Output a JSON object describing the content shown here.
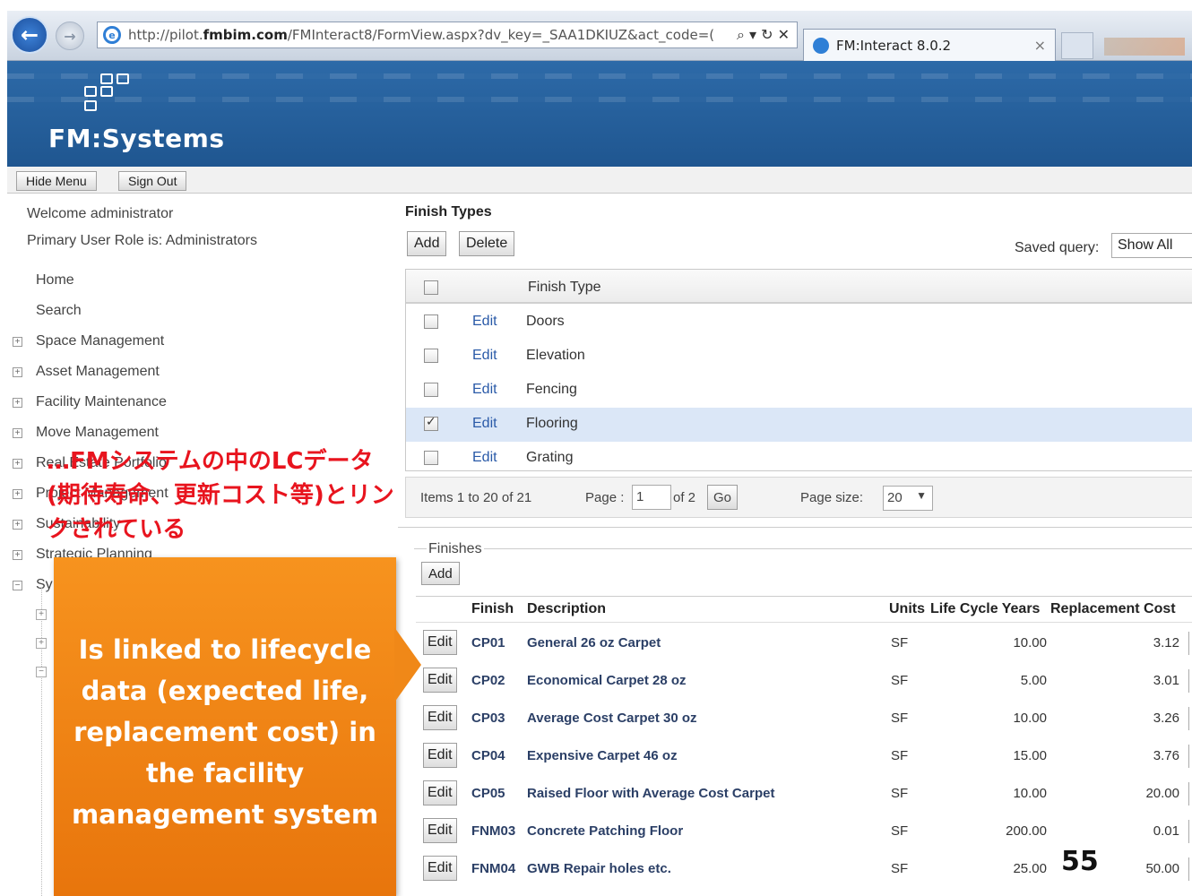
{
  "browser": {
    "url_prefix": "http://pilot.",
    "url_host": "fmbim.com",
    "url_rest": "/FMInteract8/FormView.aspx?dv_key=_SAA1DKIUZ&act_code=(",
    "addr_controls": "⌕ ▾ ↻ ✕",
    "tab_title": "FM:Interact 8.0.2",
    "tab_close": "×"
  },
  "header": {
    "brand": "FM:Systems"
  },
  "toolbar": {
    "hide_menu": "Hide Menu",
    "sign_out": "Sign Out"
  },
  "nav": {
    "welcome": "Welcome administrator",
    "role": "Primary User Role is:  Administrators",
    "items": [
      {
        "label": "Home"
      },
      {
        "label": "Search"
      },
      {
        "label": "Space Management"
      },
      {
        "label": "Asset Management"
      },
      {
        "label": "Facility Maintenance"
      },
      {
        "label": "Move Management"
      },
      {
        "label": "Real Estate Portfolio"
      },
      {
        "label": "Project Management"
      },
      {
        "label": "Sustainability"
      },
      {
        "label": "Strategic Planning"
      },
      {
        "label": "Sy"
      }
    ],
    "expander_plus": "+",
    "expander_minus": "−"
  },
  "annotation_jp": "…FMシステムの中のLCデータ(期待寿命、更新コスト等)とリンクされている",
  "callout": "Is linked to lifecycle data (expected life, replacement cost) in the facility management system",
  "finish_types": {
    "title": "Finish Types",
    "add": "Add",
    "delete": "Delete",
    "saved_query_label": "Saved query:",
    "saved_query_value": "Show All",
    "column_header": "Finish Type",
    "edit_label": "Edit",
    "rows": [
      {
        "name": "Doors",
        "checked": false
      },
      {
        "name": "Elevation",
        "checked": false
      },
      {
        "name": "Fencing",
        "checked": false
      },
      {
        "name": "Flooring",
        "checked": true
      },
      {
        "name": "Grating",
        "checked": false
      }
    ]
  },
  "pager": {
    "items": "Items 1 to 20 of 21",
    "page_label": "Page :",
    "page_value": "1",
    "of": "of 2",
    "go": "Go",
    "page_size_label": "Page size:",
    "page_size_value": "20"
  },
  "finishes": {
    "title": "Finishes",
    "add": "Add",
    "edit_label": "Edit",
    "columns": [
      "Finish",
      "Description",
      "Units",
      "Life Cycle Years",
      "Replacement Cost"
    ],
    "rows": [
      {
        "code": "CP01",
        "desc": "General 26 oz Carpet",
        "units": "SF",
        "life": "10.00",
        "cost": "3.12"
      },
      {
        "code": "CP02",
        "desc": "Economical Carpet 28 oz",
        "units": "SF",
        "life": "5.00",
        "cost": "3.01"
      },
      {
        "code": "CP03",
        "desc": "Average Cost Carpet 30 oz",
        "units": "SF",
        "life": "10.00",
        "cost": "3.26"
      },
      {
        "code": "CP04",
        "desc": "Expensive Carpet 46 oz",
        "units": "SF",
        "life": "15.00",
        "cost": "3.76"
      },
      {
        "code": "CP05",
        "desc": "Raised Floor with Average Cost Carpet",
        "units": "SF",
        "life": "10.00",
        "cost": "20.00"
      },
      {
        "code": "FNM03",
        "desc": "Concrete Patching Floor",
        "units": "SF",
        "life": "200.00",
        "cost": "0.01"
      },
      {
        "code": "FNM04",
        "desc": "GWB Repair holes etc.",
        "units": "SF",
        "life": "25.00",
        "cost": "50.00"
      }
    ]
  },
  "slide_number": "55",
  "colors": {
    "header_blue": "#1f5690",
    "callout_orange": "#f08818",
    "annotation_red": "#e8141e",
    "link_blue": "#2a5aa8"
  }
}
